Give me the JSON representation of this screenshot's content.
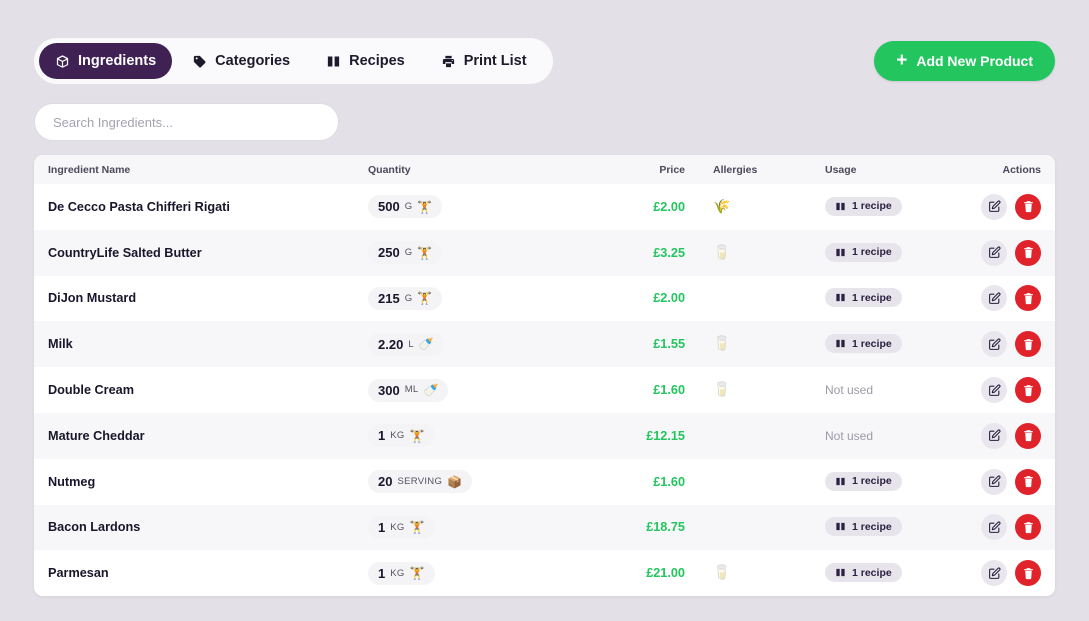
{
  "tabs": [
    {
      "label": "Ingredients",
      "icon": "box-icon",
      "active": true
    },
    {
      "label": "Categories",
      "icon": "tag-icon",
      "active": false
    },
    {
      "label": "Recipes",
      "icon": "book-icon",
      "active": false
    },
    {
      "label": "Print List",
      "icon": "printer-icon",
      "active": false
    }
  ],
  "add_button": {
    "label": "Add New Product",
    "icon": "plus-icon",
    "color": "#22c55e"
  },
  "search": {
    "value": "",
    "placeholder": "Search Ingredients..."
  },
  "table": {
    "headers": {
      "name": "Ingredient Name",
      "quantity": "Quantity",
      "price": "Price",
      "allergies": "Allergies",
      "usage": "Usage",
      "actions": "Actions"
    },
    "not_used_label": "Not used",
    "rows": [
      {
        "name": "De Cecco Pasta Chifferi Rigati",
        "qty": "500",
        "unit": "G",
        "qty_icon": "🏋",
        "price": "£2.00",
        "allergy": "🌾",
        "allergy_name": "wheat-gluten-icon",
        "usage": "1 recipe"
      },
      {
        "name": "CountryLife Salted Butter",
        "qty": "250",
        "unit": "G",
        "qty_icon": "🏋",
        "price": "£3.25",
        "allergy": "🥛",
        "allergy_name": "dairy-icon",
        "usage": "1 recipe"
      },
      {
        "name": "DiJon Mustard",
        "qty": "215",
        "unit": "G",
        "qty_icon": "🏋",
        "price": "£2.00",
        "allergy": "",
        "allergy_name": "none",
        "usage": "1 recipe"
      },
      {
        "name": "Milk",
        "qty": "2.20",
        "unit": "L",
        "qty_icon": "🍼",
        "price": "£1.55",
        "allergy": "🥛",
        "allergy_name": "dairy-icon",
        "usage": "1 recipe"
      },
      {
        "name": "Double Cream",
        "qty": "300",
        "unit": "ML",
        "qty_icon": "🍼",
        "price": "£1.60",
        "allergy": "🥛",
        "allergy_name": "dairy-icon",
        "usage": ""
      },
      {
        "name": "Mature Cheddar",
        "qty": "1",
        "unit": "KG",
        "qty_icon": "🏋",
        "price": "£12.15",
        "allergy": "",
        "allergy_name": "none",
        "usage": ""
      },
      {
        "name": "Nutmeg",
        "qty": "20",
        "unit": "SERVING",
        "qty_icon": "📦",
        "price": "£1.60",
        "allergy": "",
        "allergy_name": "none",
        "usage": "1 recipe"
      },
      {
        "name": "Bacon Lardons",
        "qty": "1",
        "unit": "KG",
        "qty_icon": "🏋",
        "price": "£18.75",
        "allergy": "",
        "allergy_name": "none",
        "usage": "1 recipe"
      },
      {
        "name": "Parmesan",
        "qty": "1",
        "unit": "KG",
        "qty_icon": "🏋",
        "price": "£21.00",
        "allergy": "🥛",
        "allergy_name": "dairy-icon",
        "usage": "1 recipe"
      }
    ]
  }
}
